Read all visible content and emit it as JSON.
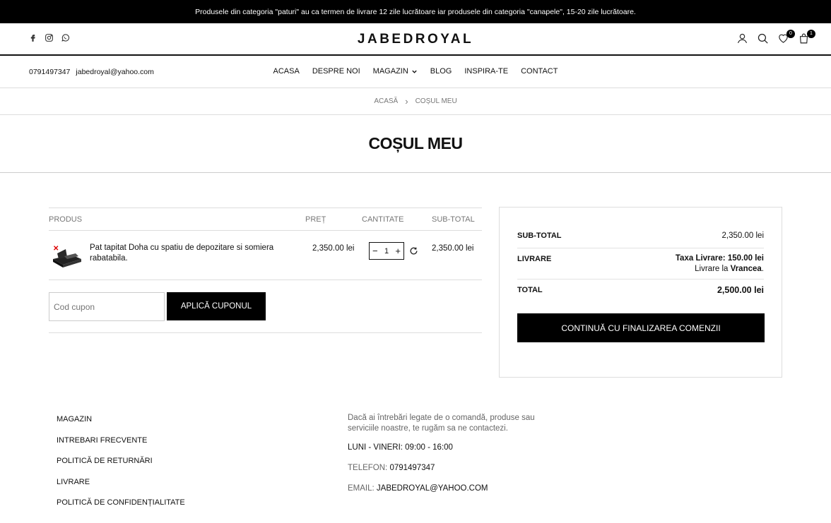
{
  "announcement": "Produsele din categoria \"paturi\" au ca termen de livrare 12 zile lucrătoare iar produsele din categoria \"canapele\", 15-20 zile lucrătoare.",
  "brand": "JABEDROYAL",
  "header": {
    "wishlist_count": "0",
    "cart_count": "1",
    "social_icons": [
      "facebook-icon",
      "instagram-icon",
      "whatsapp-icon"
    ],
    "action_icons": [
      "user-icon",
      "search-icon",
      "heart-icon",
      "bag-icon"
    ]
  },
  "contact": {
    "phone": "0791497347",
    "email": "jabedroyal@yahoo.com"
  },
  "nav": [
    "ACASA",
    "DESPRE NOI",
    "MAGAZIN",
    "BLOG",
    "INSPIRA-TE",
    "CONTACT"
  ],
  "breadcrumb": {
    "home": "ACASĂ",
    "separator": "›",
    "current": "COȘUL MEU"
  },
  "page_title": "COȘUL MEU",
  "cart": {
    "headers": {
      "product": "PRODUS",
      "price": "PREȚ",
      "quantity": "CANTITATE",
      "subtotal": "SUB-TOTAL"
    },
    "items": [
      {
        "name": "Pat tapitat Doha cu spatiu de depozitare si somiera rabatabila.",
        "price": "2,350.00 lei",
        "quantity": "1",
        "subtotal": "2,350.00 lei"
      }
    ],
    "coupon_placeholder": "Cod cupon",
    "coupon_button": "APLICĂ CUPONUL"
  },
  "totals": {
    "subtotal_label": "SUB-TOTAL",
    "subtotal_value": "2,350.00 lei",
    "shipping_label": "LIVRARE",
    "shipping_fee_label": "Taxa Livrare:",
    "shipping_fee": "150.00 lei",
    "shipping_to_label": "Livrare la",
    "shipping_region": "Vrancea",
    "total_label": "TOTAL",
    "total_value": "2,500.00 lei",
    "checkout_button": "CONTINUĂ CU FINALIZAREA COMENZII"
  },
  "footer": {
    "links": [
      "MAGAZIN",
      "INTREBARI FRECVENTE",
      "POLITICĂ DE RETURNĂRI",
      "LIVRARE",
      "POLITICĂ DE CONFIDENȚIALITATE"
    ],
    "intro": "Dacă ai întrebări legate de o comandă, produse sau serviciile noastre, te rugăm sa ne contactezi.",
    "hours": "LUNI - VINERI: 09:00 - 16:00",
    "phone_label": "TELEFON:",
    "phone": "0791497347",
    "email_label": "EMAIL:",
    "email": "JABEDROYAL@YAHOO.COM"
  }
}
